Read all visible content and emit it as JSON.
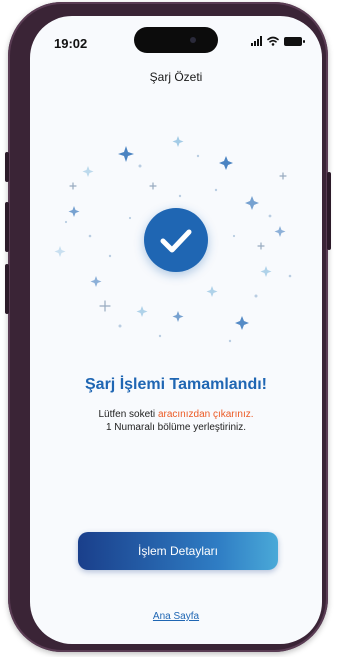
{
  "status_bar": {
    "time": "19:02",
    "icons": [
      "signal-icon",
      "wifi-icon",
      "battery-icon"
    ]
  },
  "header": {
    "title": "Şarj Özeti"
  },
  "result": {
    "icon": "check-icon",
    "heading": "Şarj İşlemi Tamamlandı!",
    "message_part1": "Lütfen soketi ",
    "message_highlight": "aracınızdan çıkarınız.",
    "message_line2": "1 Numaralı bölüme yerleştiriniz."
  },
  "actions": {
    "details_button": "İşlem Detayları",
    "home_link": "Ana Sayfa"
  },
  "colors": {
    "primary": "#1f66b3",
    "accent": "#ec5a24",
    "frame": "#3a2436"
  }
}
